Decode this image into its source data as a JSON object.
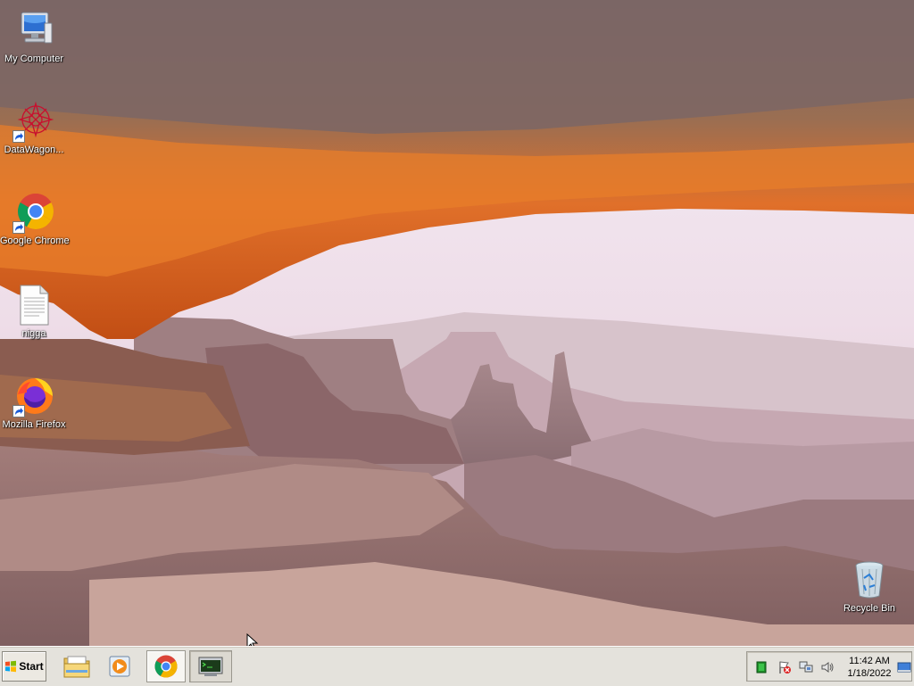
{
  "desktop": {
    "icons": [
      {
        "label": "My Computer",
        "icon": "computer-icon"
      },
      {
        "label": "DataWagon...",
        "icon": "datawagon-icon"
      },
      {
        "label": "Google Chrome",
        "icon": "chrome-icon"
      },
      {
        "label": "nigga",
        "icon": "text-file-icon"
      },
      {
        "label": "Mozilla Firefox",
        "icon": "firefox-icon"
      },
      {
        "label": "Recycle Bin",
        "icon": "recycle-bin-icon"
      }
    ]
  },
  "taskbar": {
    "start_label": "Start",
    "apps": [
      {
        "icon": "file-explorer-icon"
      },
      {
        "icon": "media-player-icon"
      },
      {
        "icon": "chrome-icon",
        "state": "active"
      },
      {
        "icon": "terminal-window-icon",
        "state": "pressed"
      }
    ],
    "tray": {
      "icons": [
        "green-status-icon",
        "action-center-flag-icon",
        "network-icon",
        "volume-icon",
        "show-desktop-icon"
      ],
      "time": "11:42 AM",
      "date": "1/18/2022"
    }
  },
  "colors": {
    "taskbar_bg": "#e4e2dc",
    "sky": "#efe3ec",
    "rock_orange": "#d86a1e",
    "rock_purple": "#8d6868"
  }
}
